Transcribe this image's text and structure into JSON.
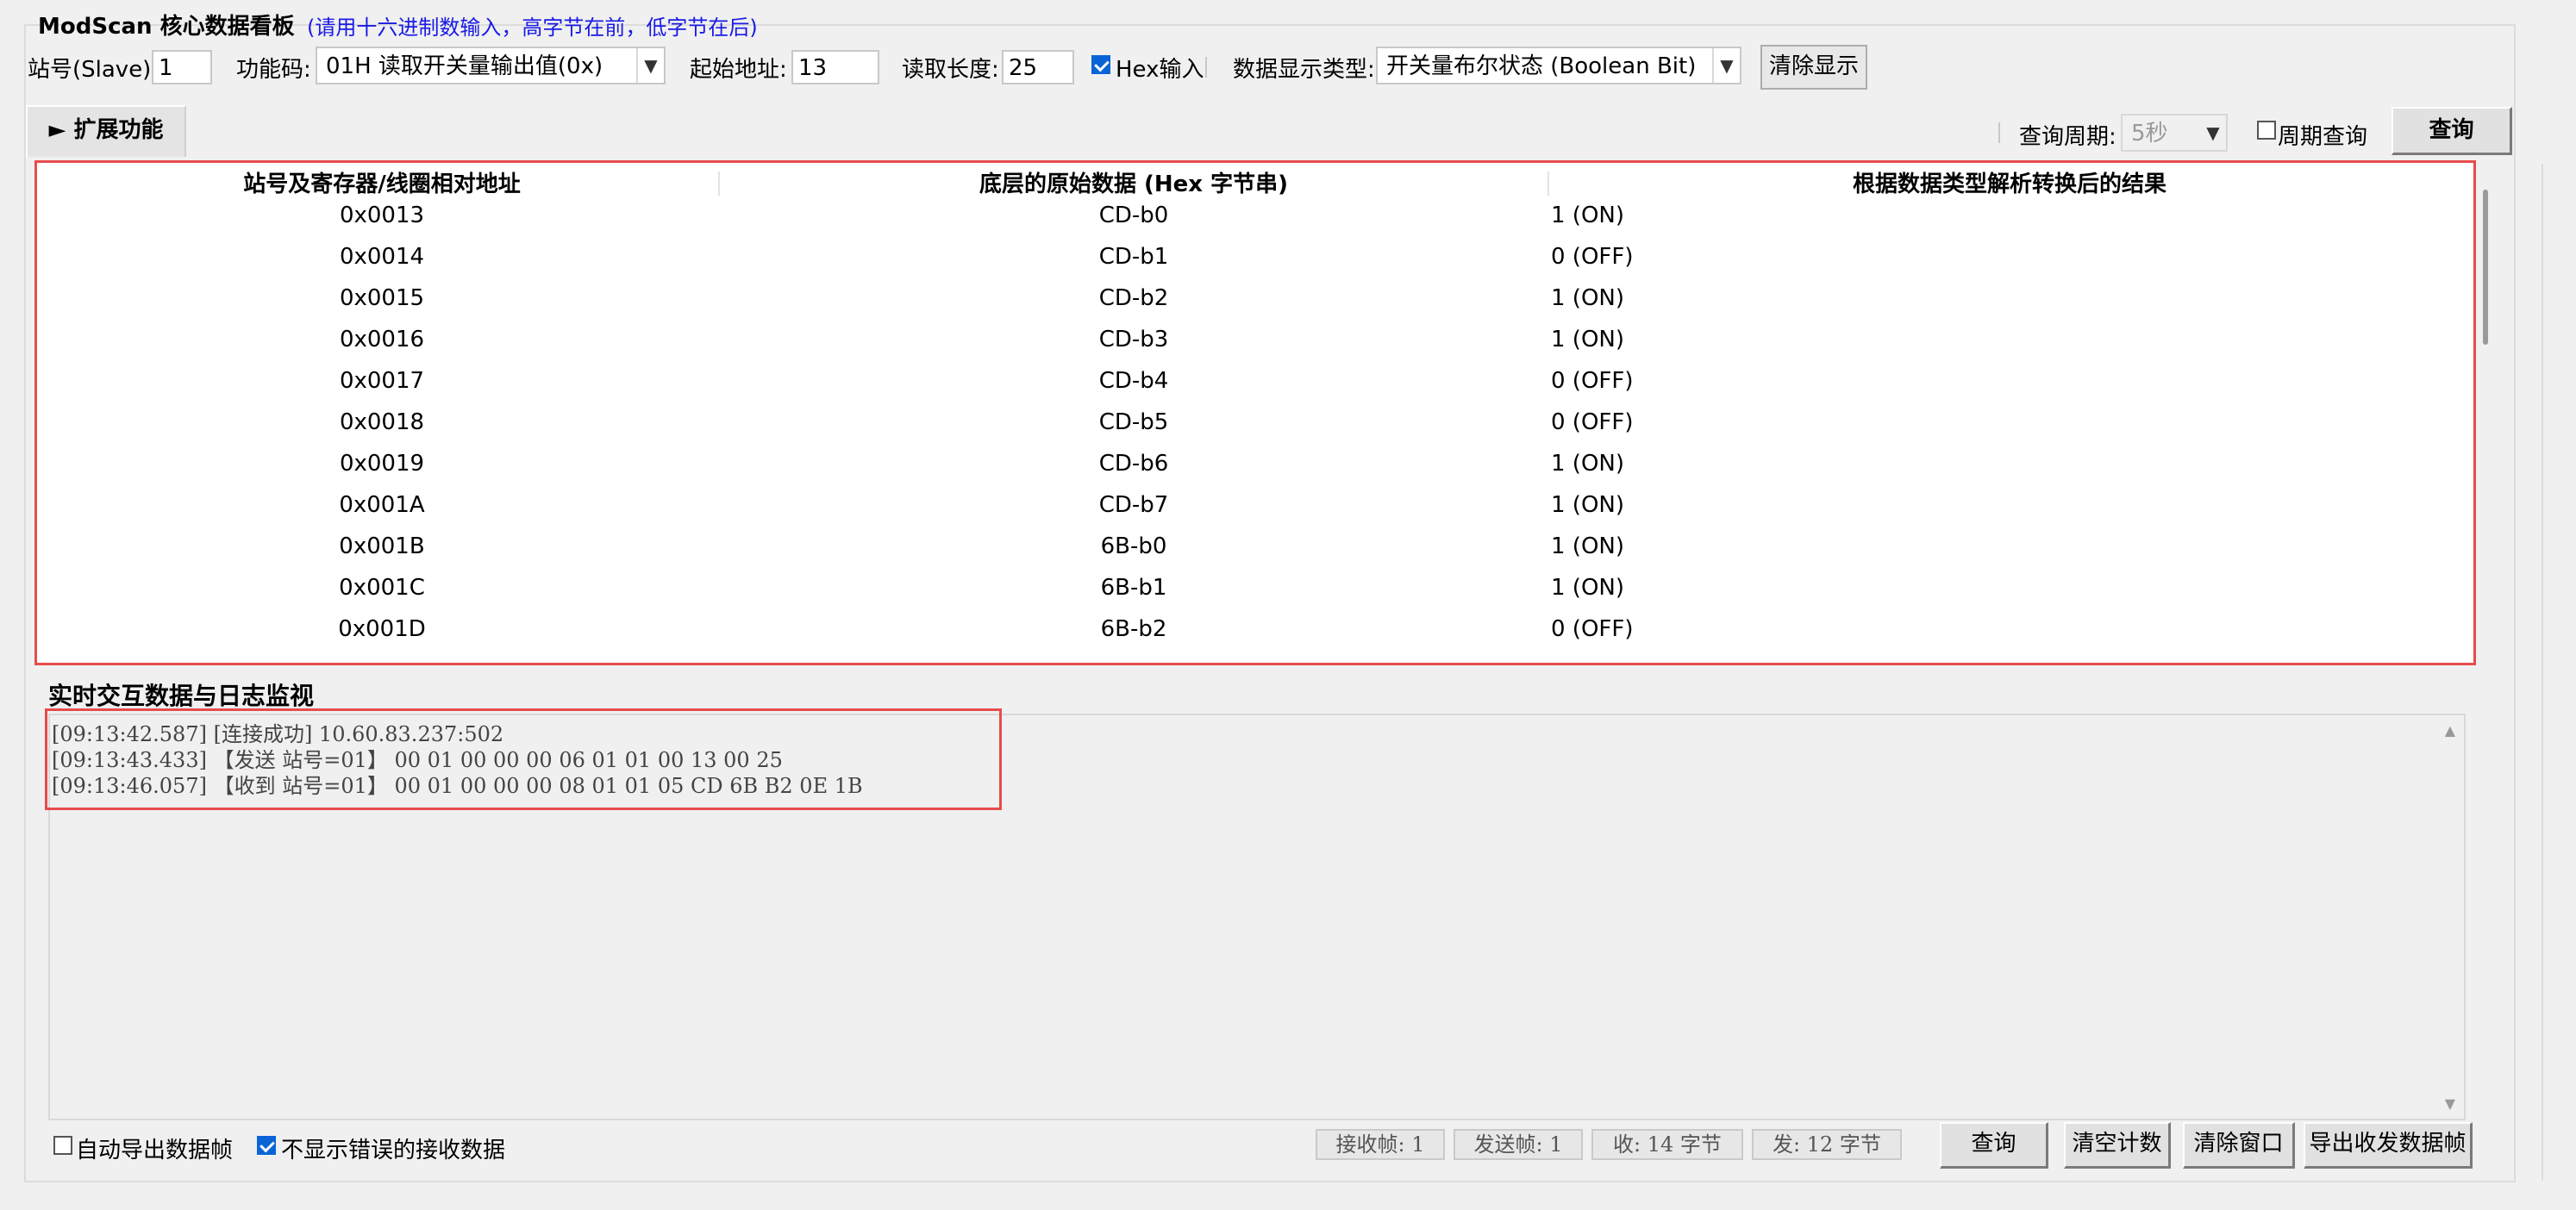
{
  "header": {
    "title": "ModScan 核心数据看板",
    "hint": "(请用十六进制数输入，高字节在前，低字节在后)"
  },
  "toolbar": {
    "slave_label": "站号(Slave):",
    "slave_value": "1",
    "func_label": "功能码:",
    "func_value": "01H 读取开关量输出值(0x)",
    "start_label": "起始地址:",
    "start_value": "13",
    "length_label": "读取长度:",
    "length_value": "25",
    "hex_label": "Hex输入",
    "type_label": "数据显示类型:",
    "type_value": "开关量布尔状态 (Boolean Bit)",
    "clear_button": "清除显示"
  },
  "ext": {
    "toggle_label": "► 扩展功能",
    "period_label": "查询周期:",
    "period_value": "5秒",
    "periodic_label": "周期查询",
    "query_button": "查询"
  },
  "table": {
    "headers": [
      "站号及寄存器/线圈相对地址",
      "底层的原始数据 (Hex 字节串)",
      "根据数据类型解析转换后的结果"
    ],
    "rows": [
      [
        "0x0013",
        "CD-b0",
        "1 (ON)"
      ],
      [
        "0x0014",
        "CD-b1",
        "0 (OFF)"
      ],
      [
        "0x0015",
        "CD-b2",
        "1 (ON)"
      ],
      [
        "0x0016",
        "CD-b3",
        "1 (ON)"
      ],
      [
        "0x0017",
        "CD-b4",
        "0 (OFF)"
      ],
      [
        "0x0018",
        "CD-b5",
        "0 (OFF)"
      ],
      [
        "0x0019",
        "CD-b6",
        "1 (ON)"
      ],
      [
        "0x001A",
        "CD-b7",
        "1 (ON)"
      ],
      [
        "0x001B",
        "6B-b0",
        "1 (ON)"
      ],
      [
        "0x001C",
        "6B-b1",
        "1 (ON)"
      ],
      [
        "0x001D",
        "6B-b2",
        "0 (OFF)"
      ]
    ]
  },
  "log": {
    "title": "实时交互数据与日志监视",
    "lines": [
      "[09:13:42.587] [连接成功] 10.60.83.237:502",
      "[09:13:43.433] 【发送 站号=01】 00 01 00 00 00 06 01 01 00 13 00 25",
      "[09:13:46.057] 【收到 站号=01】 00 01 00 00 00 08 01 01 05 CD 6B B2 0E 1B"
    ]
  },
  "footer": {
    "auto_export_label": "自动导出数据帧",
    "hide_error_label": "不显示错误的接收数据",
    "rx_frames": "接收帧: 1",
    "tx_frames": "发送帧: 1",
    "rx_bytes": "收: 14 字节",
    "tx_bytes": "发: 12 字节",
    "query_button": "查询",
    "clear_count_button": "清空计数",
    "clear_window_button": "清除窗口",
    "export_button": "导出收发数据帧"
  }
}
